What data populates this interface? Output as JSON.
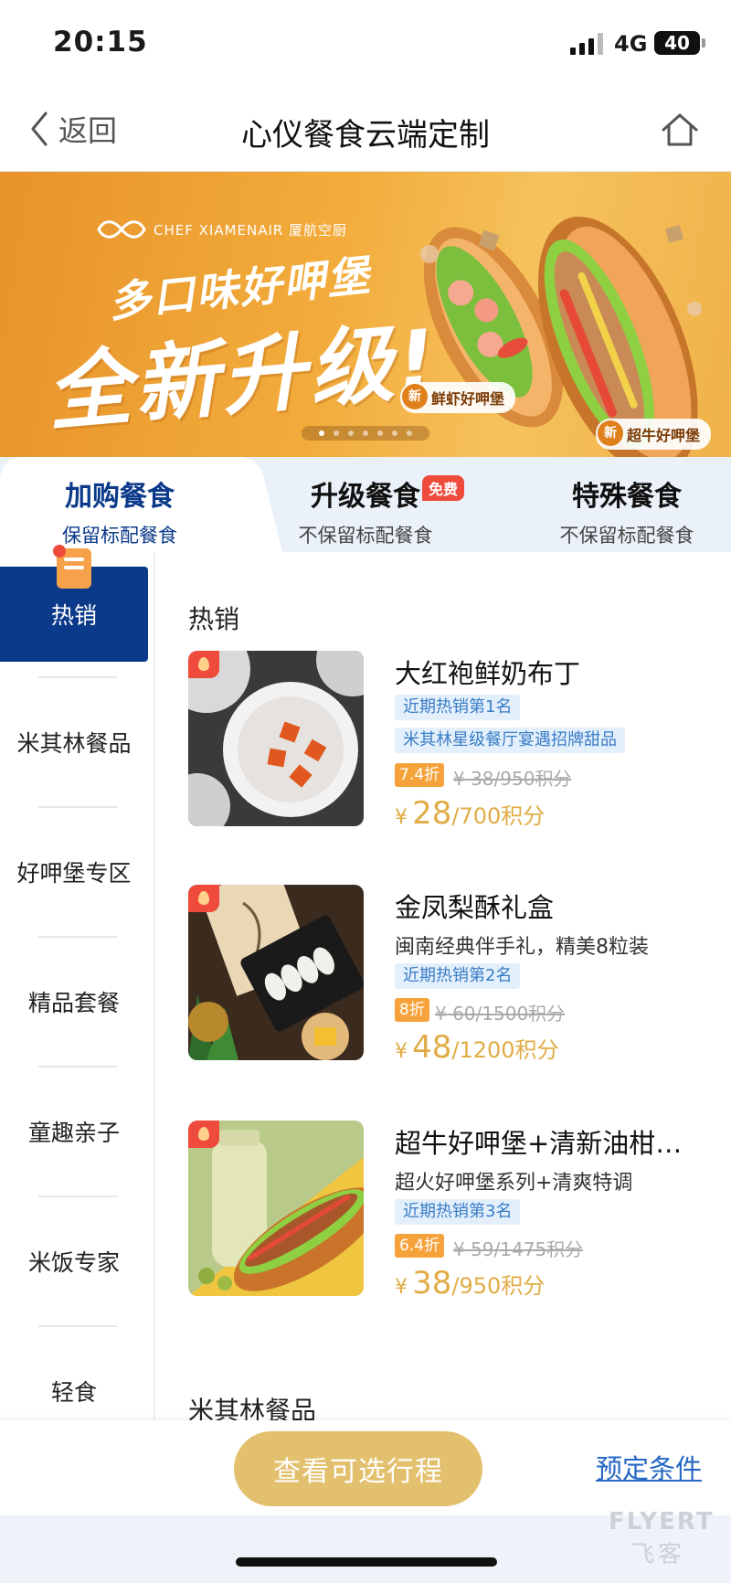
{
  "status_bar": {
    "time": "20:15",
    "network": "4G",
    "battery": "40"
  },
  "nav": {
    "back_label": "返回",
    "title": "心仪餐食云端定制"
  },
  "banner": {
    "brand": "CHEF XIAMENAIR 厦航空厨",
    "headline1": "多口味好呷堡",
    "headline2": "全新升级!",
    "tag1": "鲜虾好呷堡",
    "tag2": "超牛好呷堡",
    "new_label": "新",
    "slide_count": 7,
    "active_slide": 1
  },
  "tabs": [
    {
      "title": "加购餐食",
      "subtitle": "保留标配餐食",
      "active": true
    },
    {
      "title": "升级餐食",
      "subtitle": "不保留标配餐食",
      "badge": "免费"
    },
    {
      "title": "特殊餐食",
      "subtitle": "不保留标配餐食"
    }
  ],
  "sidebar": {
    "items": [
      {
        "label": "热销",
        "active": true
      },
      {
        "label": "米其林餐品"
      },
      {
        "label": "好呷堡专区"
      },
      {
        "label": "精品套餐"
      },
      {
        "label": "童趣亲子"
      },
      {
        "label": "米饭专家"
      },
      {
        "label": "轻食"
      }
    ]
  },
  "sections": {
    "hot_title": "热销",
    "michelin_title": "米其林餐品"
  },
  "products": [
    {
      "name": "大红袍鲜奶布丁",
      "description": "",
      "tags": [
        "近期热销第1名",
        "米其林星级餐厅宴遇招牌甜品"
      ],
      "discount": "7.4折",
      "original_price": "¥ 38/950积分",
      "currency": "¥",
      "price": "28",
      "points": "/700积分"
    },
    {
      "name": "金凤梨酥礼盒",
      "description": "闽南经典伴手礼，精美8粒装",
      "tags": [
        "近期热销第2名"
      ],
      "discount": "8折",
      "original_price": "¥ 60/1500积分",
      "currency": "¥",
      "price": "48",
      "points": "/1200积分"
    },
    {
      "name": "超牛好呷堡+清新油柑…",
      "description": "超火好呷堡系列+清爽特调",
      "tags": [
        "近期热销第3名"
      ],
      "discount": "6.4折",
      "original_price": "¥ 59/1475积分",
      "currency": "¥",
      "price": "38",
      "points": "/950积分"
    }
  ],
  "bottom": {
    "itinerary_button": "查看可选行程",
    "conditions_link": "预定条件"
  },
  "watermark": {
    "text": "FLYERT",
    "sub": "飞客"
  },
  "colors": {
    "primary_navy": "#0b3a8a",
    "accent_gold": "#e3c06d",
    "price_gold": "#e1ac45",
    "discount_orange": "#f5a23a",
    "tag_blue_bg": "#e3f0fc",
    "link_blue": "#2567c4",
    "badge_red": "#ee4b3c"
  }
}
